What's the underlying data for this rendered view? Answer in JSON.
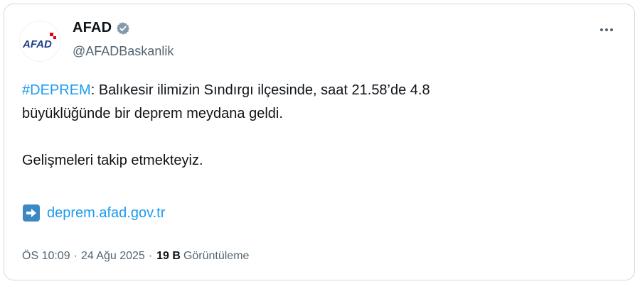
{
  "author": {
    "logo_text": "AFAD",
    "display_name": "AFAD",
    "handle": "@AFADBaskanlik",
    "verified_icon": "verified-badge-icon",
    "avatar_icon": "afad-logo",
    "verified_color": "#829aab"
  },
  "tweet": {
    "hashtag": "#DEPREM",
    "text_line1": ": Balıkesir ilimizin Sındırgı ilçesinde, saat 21.58’de 4.8",
    "text_line2": "büyüklüğünde bir deprem meydana geldi.",
    "text_line3": "Gelişmeleri takip etmekteyiz.",
    "link_icon": "right-arrow-emoji-icon",
    "link_text": "deprem.afad.gov.tr"
  },
  "meta": {
    "time": "ÖS 10:09",
    "separator": "·",
    "date": "24 Ağu 2025",
    "views_count": "19 B",
    "views_label": "Görüntüleme"
  },
  "colors": {
    "text": "#0f1419",
    "secondary": "#536471",
    "link": "#1d9bf0",
    "border": "#cfd9de",
    "logo_red": "#e3000f",
    "logo_blue": "#1e3e8a"
  }
}
